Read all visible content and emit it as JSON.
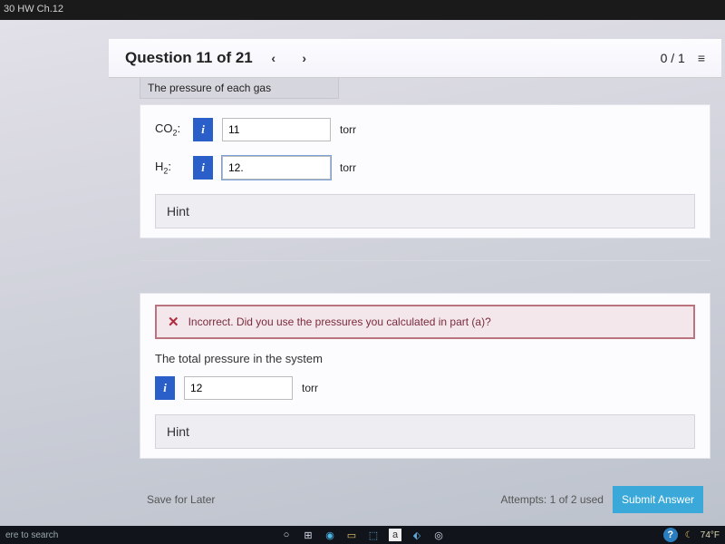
{
  "window": {
    "title": "30 HW Ch.12"
  },
  "header": {
    "question_label": "Question 11 of 21",
    "prev": "‹",
    "next": "›",
    "score": "0 / 1"
  },
  "partA": {
    "caption": "The pressure of each gas",
    "rows": [
      {
        "label_html": "CO",
        "sub": "2",
        "value": "11",
        "unit": "torr"
      },
      {
        "label_html": "H",
        "sub": "2",
        "value": "12.",
        "unit": "torr"
      }
    ],
    "hint_label": "Hint"
  },
  "partB": {
    "feedback": "Incorrect. Did you use the pressures you calculated in part (a)?",
    "caption": "The total pressure in the system",
    "value": "12",
    "unit": "torr",
    "hint_label": "Hint"
  },
  "footer": {
    "save_label": "Save for Later",
    "attempts": "Attempts: 1 of 2 used",
    "submit_label": "Submit Answer"
  },
  "taskbar": {
    "search": "ere to search",
    "temp": "74°F"
  },
  "icons": {
    "info": "i",
    "close_x": "✕",
    "list": "≡"
  }
}
